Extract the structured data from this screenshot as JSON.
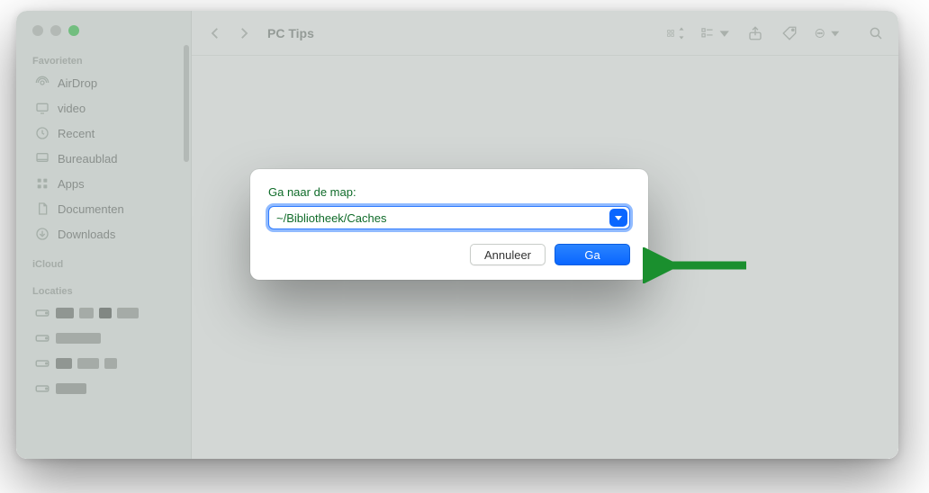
{
  "window": {
    "title": "PC Tips"
  },
  "sidebar": {
    "sections": {
      "favorites": "Favorieten",
      "icloud": "iCloud",
      "locations": "Locaties"
    },
    "items": [
      {
        "icon": "airdrop",
        "label": "AirDrop"
      },
      {
        "icon": "display",
        "label": "video"
      },
      {
        "icon": "clock",
        "label": "Recent"
      },
      {
        "icon": "desktop",
        "label": "Bureaublad"
      },
      {
        "icon": "apps",
        "label": "Apps"
      },
      {
        "icon": "document",
        "label": "Documenten"
      },
      {
        "icon": "download",
        "label": "Downloads"
      }
    ]
  },
  "dialog": {
    "label": "Ga naar de map:",
    "path_value": "~/Bibliotheek/Caches",
    "cancel": "Annuleer",
    "go": "Ga"
  },
  "colors": {
    "accent": "#0a66ff",
    "green": "#0f6b29",
    "arrow": "#1a8f2e"
  }
}
